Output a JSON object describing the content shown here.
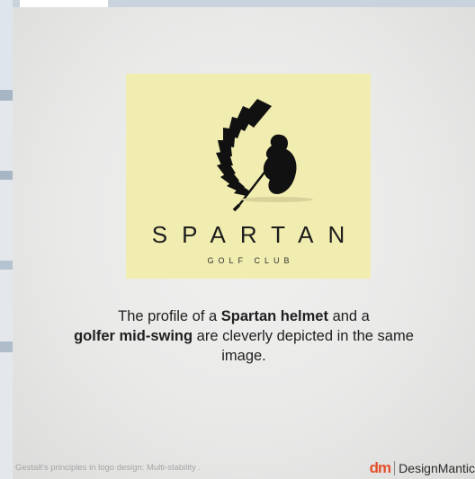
{
  "slide": {
    "logo": {
      "name": "SPARTAN",
      "tagline": "GOLF CLUB",
      "background": "#f1ecb0",
      "art_icon": "spartan-helmet-golfer-icon"
    },
    "caption": {
      "part1": "The profile of a ",
      "bold1": "Spartan helmet",
      "part2": " and a ",
      "bold2": "golfer mid-swing",
      "part3": " are cleverly depicted in the same image."
    },
    "footer": {
      "text": "Gestalt's principles in logo design: Multi-stability .",
      "brand_mark": "dm",
      "brand_name": "DesignMantic"
    }
  },
  "colors": {
    "brand_accent": "#e4502b",
    "text": "#1f1f1f",
    "frame": "#c9d3dd"
  }
}
